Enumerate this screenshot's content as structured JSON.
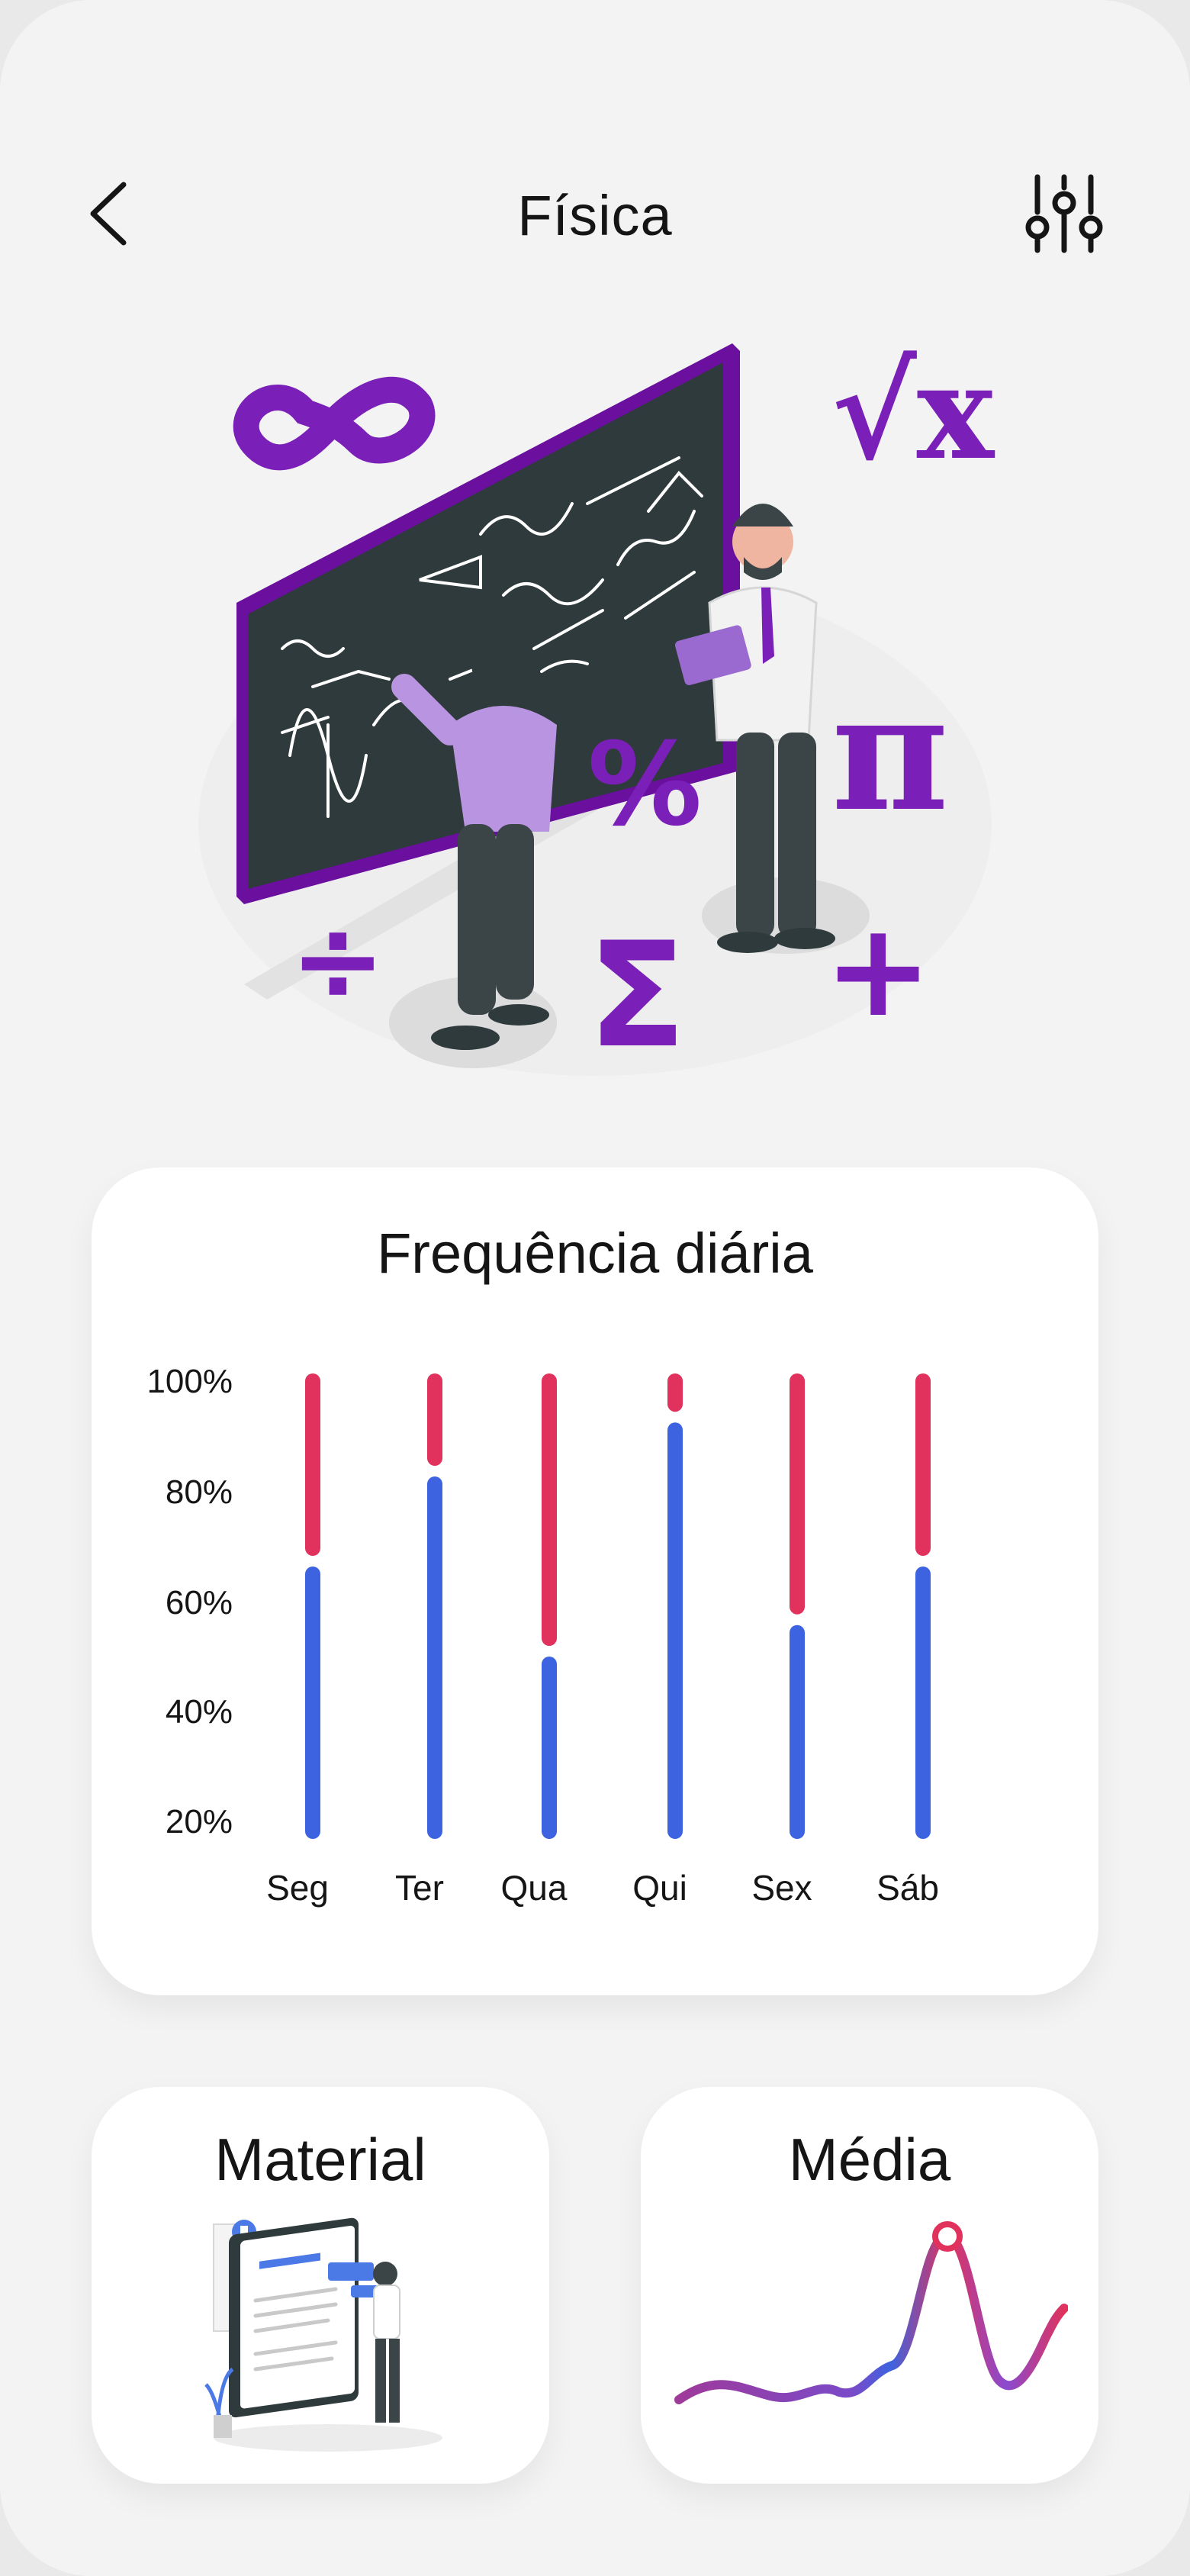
{
  "header": {
    "title": "Física",
    "back_icon": "chevron-left-icon",
    "filter_icon": "sliders-icon"
  },
  "hero": {
    "illustration": "teacher-blackboard-illustration"
  },
  "frequency_card": {
    "title": "Frequência diária"
  },
  "chart_data": {
    "type": "bar",
    "title": "Frequência diária",
    "categories": [
      "Seg",
      "Ter",
      "Qua",
      "Qui",
      "Sex",
      "Sáb"
    ],
    "y_ticks": [
      "100%",
      "80%",
      "60%",
      "40%",
      "20%"
    ],
    "ylim": [
      15,
      100
    ],
    "series": [
      {
        "color": "#3d63e0",
        "values": [
          60,
          80,
          40,
          92,
          47,
          60
        ]
      },
      {
        "color": "#e0325c",
        "values": [
          40,
          20,
          60,
          8,
          53,
          40
        ]
      }
    ]
  },
  "material_card": {
    "title": "Material",
    "illustration": "study-materials-illustration"
  },
  "media_card": {
    "title": "Média",
    "icon": "average-wave-graph-icon"
  },
  "colors": {
    "accent_purple": "#7a1fb8",
    "bar_blue": "#3d63e0",
    "bar_red": "#e0325c"
  }
}
